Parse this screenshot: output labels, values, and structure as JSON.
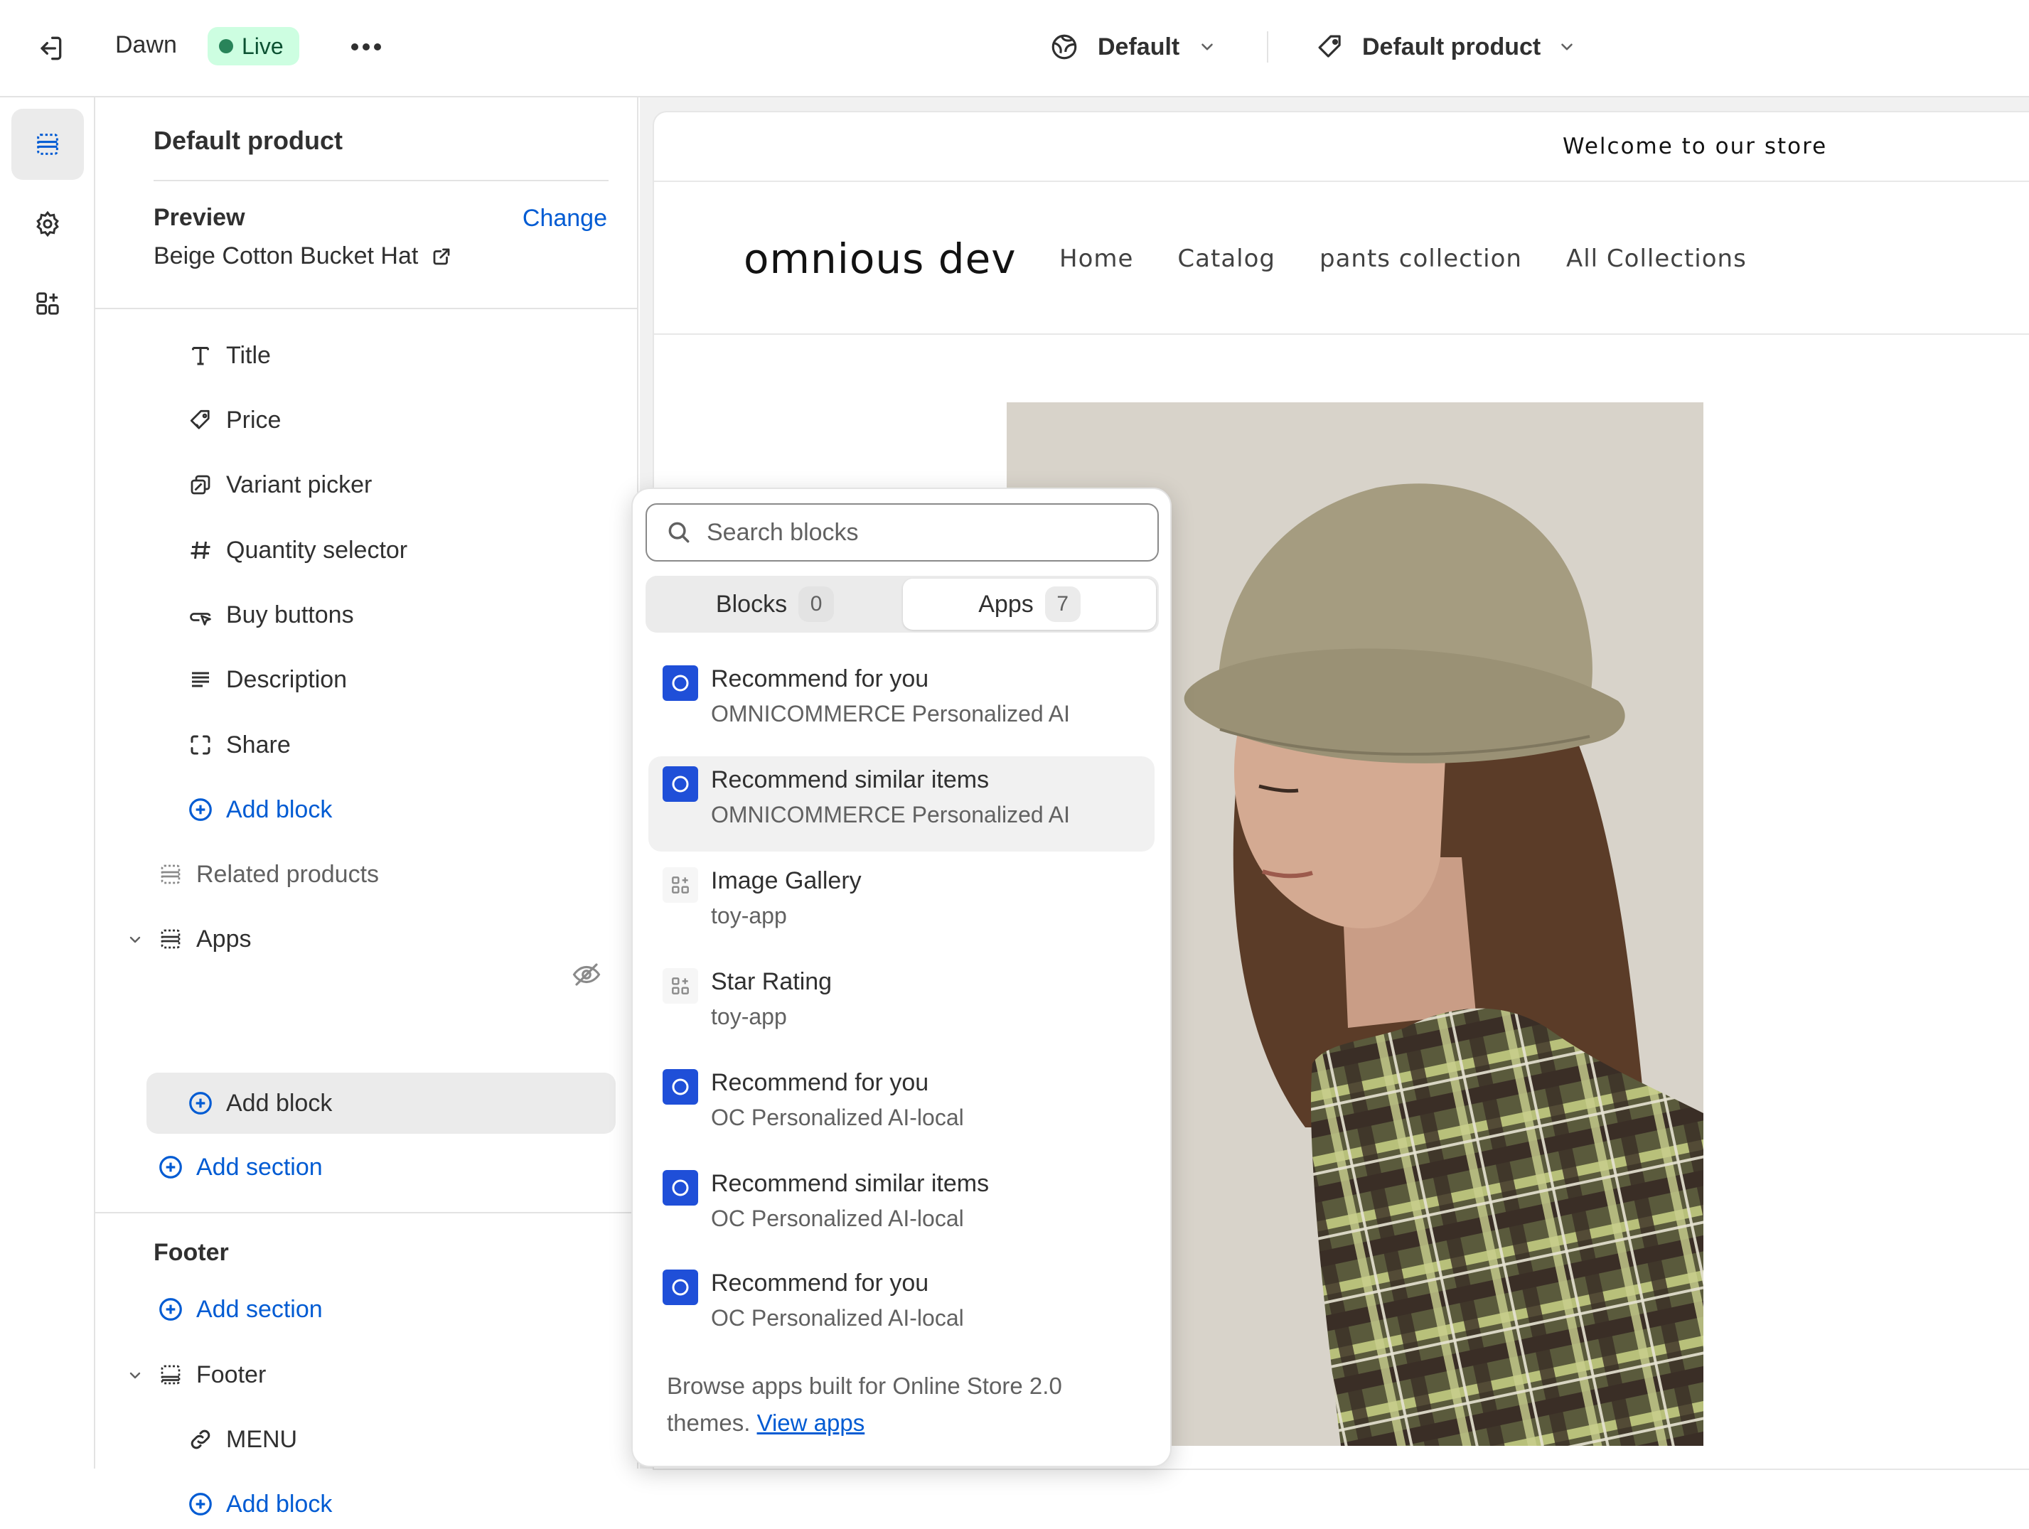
{
  "topbar": {
    "theme_name": "Dawn",
    "status": "Live",
    "language_select": "Default",
    "template_select": "Default product"
  },
  "panel": {
    "title": "Default product",
    "preview_label": "Preview",
    "change_label": "Change",
    "preview_product": "Beige Cotton Bucket Hat",
    "blocks": [
      {
        "label": "Title",
        "icon": "text-icon"
      },
      {
        "label": "Price",
        "icon": "price-tag-icon"
      },
      {
        "label": "Variant picker",
        "icon": "variant-icon"
      },
      {
        "label": "Quantity selector",
        "icon": "hash-icon"
      },
      {
        "label": "Buy buttons",
        "icon": "cursor-button-icon"
      },
      {
        "label": "Description",
        "icon": "text-align-icon"
      },
      {
        "label": "Share",
        "icon": "share-frame-icon"
      }
    ],
    "add_block": "Add block",
    "related_products": "Related products",
    "apps_section": "Apps",
    "apps_add_block": "Add block",
    "add_section": "Add section",
    "footer_group": "Footer",
    "footer_add_section": "Add section",
    "footer_section": "Footer",
    "footer_menu": "MENU",
    "footer_add_block": "Add block"
  },
  "store": {
    "announcement": "Welcome to our store",
    "logo": "omnious dev",
    "nav": [
      "Home",
      "Catalog",
      "pants collection",
      "All Collections"
    ]
  },
  "popover": {
    "search_placeholder": "Search blocks",
    "tabs": [
      {
        "label": "Blocks",
        "count": "0"
      },
      {
        "label": "Apps",
        "count": "7"
      }
    ],
    "apps": [
      {
        "name": "Recommend for you",
        "vendor": "OMNICOMMERCE Personalized AI",
        "icon": "omni-app-icon"
      },
      {
        "name": "Recommend similar items",
        "vendor": "OMNICOMMERCE Personalized AI",
        "icon": "omni-app-icon"
      },
      {
        "name": "Image Gallery",
        "vendor": "toy-app",
        "icon": "app-block-icon"
      },
      {
        "name": "Star Rating",
        "vendor": "toy-app",
        "icon": "app-block-icon"
      },
      {
        "name": "Recommend for you",
        "vendor": "OC Personalized AI-local",
        "icon": "omni-app-icon"
      },
      {
        "name": "Recommend similar items",
        "vendor": "OC Personalized AI-local",
        "icon": "omni-app-icon"
      },
      {
        "name": "Recommend for you",
        "vendor": "OC Personalized AI-local",
        "icon": "omni-app-icon"
      }
    ],
    "footer_text": "Browse apps built for Online Store 2.0 themes.",
    "footer_link": "View apps"
  },
  "colors": {
    "accent_blue": "#005bd3",
    "live_badge_bg": "#cdfee1",
    "live_dot": "#29845a",
    "app_icon_blue": "#1f4fd8"
  }
}
